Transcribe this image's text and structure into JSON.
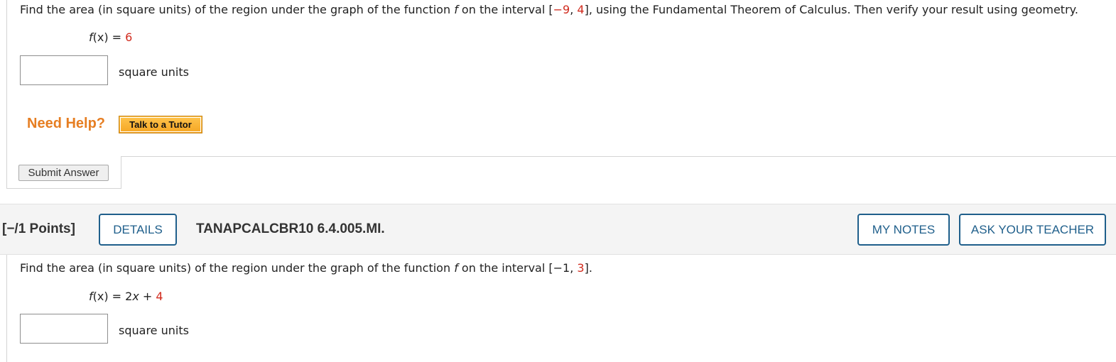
{
  "question1": {
    "prompt": {
      "p1": "Find the area (in square units) of the region under the graph of the function ",
      "fn": "f",
      "p2": " on the interval [",
      "a": "−9",
      "sep": ", ",
      "b": "4",
      "p3": "], using the Fundamental Theorem of Calculus. Then verify your result using geometry."
    },
    "function": {
      "lhs_f": "f",
      "lhs_rest": "(x) = ",
      "rhs": "6"
    },
    "answer_value": "",
    "units": "square units",
    "need_help": "Need Help?",
    "tutor_button": "Talk to a Tutor",
    "submit_button": "Submit Answer"
  },
  "question2": {
    "points": "[−/1 Points]",
    "details_button": "DETAILS",
    "code": "TANAPCALCBR10 6.4.005.MI.",
    "my_notes_button": "MY NOTES",
    "ask_teacher_button": "ASK YOUR TEACHER",
    "prompt": {
      "p1": "Find the area (in square units) of the region under the graph of the function ",
      "fn": "f",
      "p2": " on the interval [",
      "a": "−1",
      "sep": ", ",
      "b": "3",
      "p3": "]."
    },
    "function": {
      "lhs_f": "f",
      "lhs_x": "(x) = 2",
      "x": "x",
      "plus": " + ",
      "rhs": "4"
    },
    "answer_value": "",
    "units": "square units"
  },
  "colors": {
    "accent_red": "#d12b1e",
    "help_orange": "#e67e22",
    "button_blue": "#1f5f8b"
  }
}
